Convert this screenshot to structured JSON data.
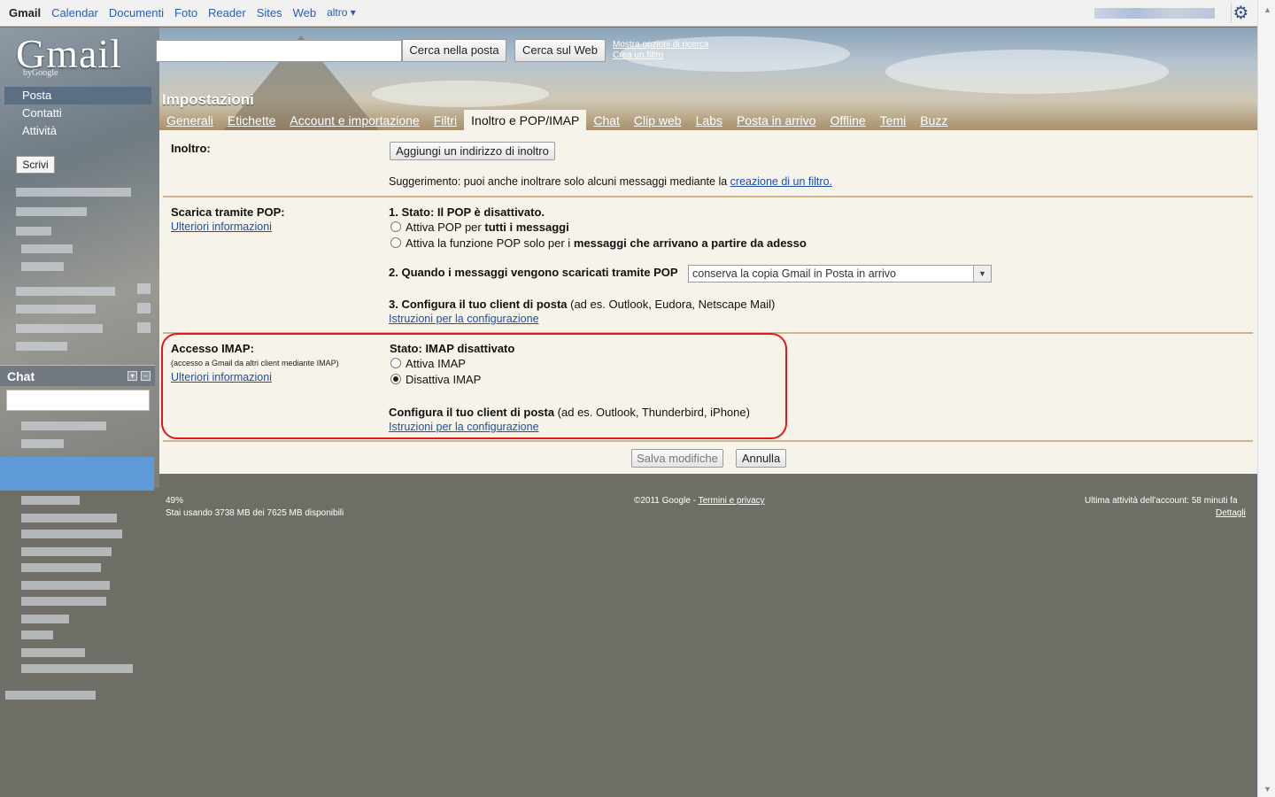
{
  "topbar": {
    "brand": "Gmail",
    "links": [
      "Calendar",
      "Documenti",
      "Foto",
      "Reader",
      "Sites",
      "Web",
      "altro ▾"
    ]
  },
  "logo": {
    "text": "Gmail",
    "sub": "byGoogle"
  },
  "search": {
    "value": "",
    "search_mail_button": "Cerca nella posta",
    "search_web_button": "Cerca sul Web",
    "options_link": "Mostra opzioni di ricerca",
    "filter_link": "Crea un filtro"
  },
  "leftnav": {
    "items": [
      "Posta",
      "Contatti",
      "Attività"
    ],
    "compose": "Scrivi"
  },
  "chat": {
    "title": "Chat"
  },
  "settings": {
    "title": "Impostazioni",
    "tabs": [
      "Generali",
      "Etichette",
      "Account e importazione",
      "Filtri",
      "Inoltro e POP/IMAP",
      "Chat",
      "Clip web",
      "Labs",
      "Posta in arrivo",
      "Offline",
      "Temi",
      "Buzz"
    ],
    "active_tab": "Inoltro e POP/IMAP",
    "forwarding": {
      "label": "Inoltro:",
      "add_button": "Aggiungi un indirizzo di inoltro",
      "tip": "Suggerimento: puoi anche inoltrare solo alcuni messaggi mediante la ",
      "tip_link": "creazione di un filtro."
    },
    "pop": {
      "label": "Scarica tramite POP:",
      "more_info": "Ulteriori informazioni",
      "status": "1. Stato: Il POP è disattivato.",
      "opt1_a": "Attiva POP per ",
      "opt1_b": "tutti i messaggi",
      "opt2_a": "Attiva la funzione POP solo per i ",
      "opt2_b": "messaggi che arrivano a partire da adesso",
      "when_label": "2. Quando i messaggi vengono scaricati tramite POP",
      "when_value": "conserva la copia Gmail in Posta in arrivo",
      "configure_a": "3. Configura il tuo client di posta",
      "configure_b": " (ad es. Outlook, Eudora, Netscape Mail)",
      "configure_link": "Istruzioni per la configurazione"
    },
    "imap": {
      "label": "Accesso IMAP:",
      "sub": "(accesso a Gmail da altri client mediante IMAP)",
      "more_info": "Ulteriori informazioni",
      "status": "Stato: IMAP disattivato",
      "enable": "Attiva IMAP",
      "disable": "Disattiva IMAP",
      "selected": "disable",
      "configure_a": "Configura il tuo client di posta",
      "configure_b": " (ad es. Outlook, Thunderbird, iPhone)",
      "configure_link": "Istruzioni per la configurazione"
    },
    "save_button": "Salva modifiche",
    "cancel_button": "Annulla"
  },
  "footer": {
    "usage_percent": "49%",
    "usage_text": "Stai usando 3738 MB dei 7625 MB disponibili",
    "copyright": "©2011 Google - ",
    "terms_link": "Termini e privacy",
    "last_activity": "Ultima attività dell'account: 58 minuti fa",
    "details_link": "Dettagli"
  },
  "colors": {
    "highlight": "#e01818",
    "panel": "#f6f3ea",
    "link": "#1f4ea8",
    "separator": "#cfb38c"
  }
}
